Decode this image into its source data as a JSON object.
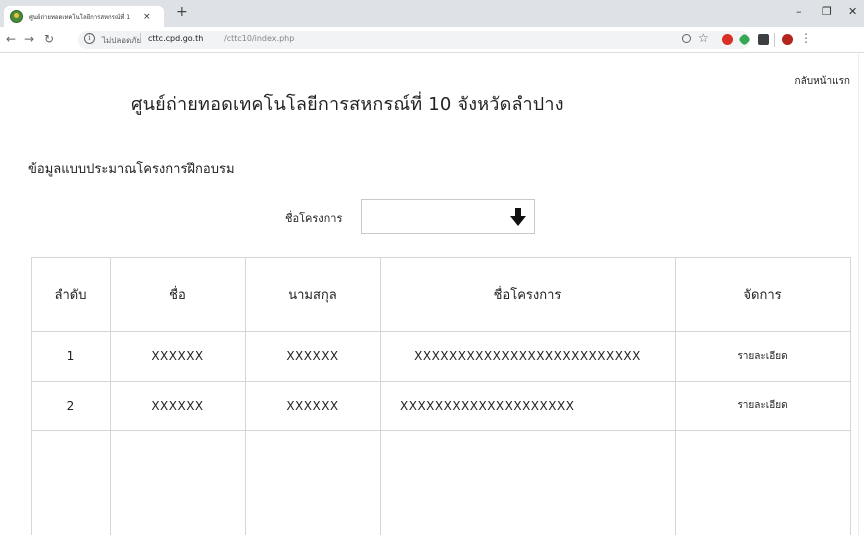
{
  "browser": {
    "tab_title": "ศูนย์ถ่ายทอดเทคโนโลยีการสหกรณ์ที่ 1",
    "tab_close": "×",
    "new_tab": "+",
    "security_text": "ไม่ปลอดภัย",
    "url_host": "cttc.cpd.go.th",
    "url_path": "/cttc10/index.php",
    "window_controls": [
      "–",
      "❐",
      "✕"
    ]
  },
  "page": {
    "back_home": "กลับหน้าแรก",
    "title": "ศูนย์ถ่ายทอดเทคโนโลยีการสหกรณ์ที่ 10 จังหวัดลำปาง",
    "section_title": "ข้อมูลแบบประมาณโครงการฝึกอบรม",
    "filter": {
      "label": "ชื่อโครงการ",
      "value": ""
    },
    "table": {
      "headers": [
        "ลำดับ",
        "ชื่อ",
        "นามสกุล",
        "ชื่อโครงการ",
        "จัดการ"
      ],
      "rows": [
        {
          "no": "1",
          "first_name": "XXXXXX",
          "last_name": "XXXXXX",
          "project": "XXXXXXXXXXXXXXXXXXXXXXXXXX",
          "action": "รายละเอียด"
        },
        {
          "no": "2",
          "first_name": "XXXXXX",
          "last_name": "XXXXXX",
          "project": "XXXXXXXXXXXXXXXXXXXX",
          "action": "รายละเอียด"
        }
      ]
    }
  },
  "icons": [
    "favicon",
    "back-arrow-icon",
    "forward-arrow-icon",
    "reload-icon",
    "info-icon",
    "zoom-icon",
    "star-icon",
    "extension-icon",
    "profile-icon",
    "menu-icon",
    "arrow-down-icon"
  ]
}
